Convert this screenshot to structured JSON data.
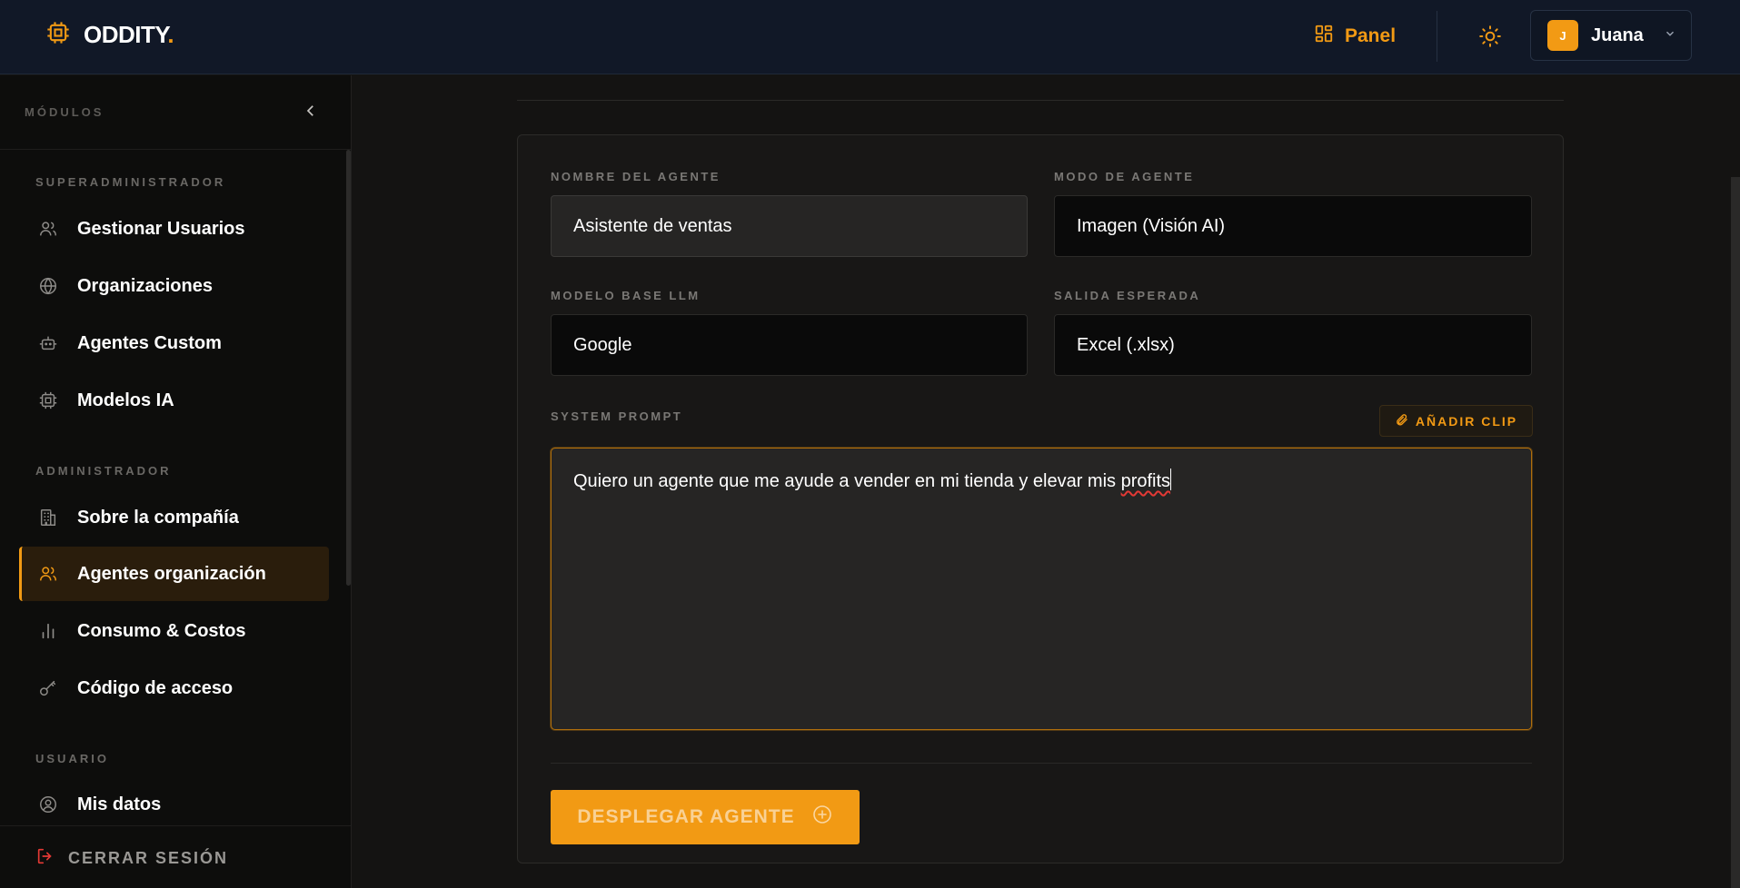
{
  "app": {
    "logo_text": "ODDITY",
    "logo_dot": ".",
    "logo_icon": "chip-icon"
  },
  "topbar": {
    "panel_label": "Panel",
    "panel_icon": "grid-icon",
    "theme_icon": "sun-icon",
    "user": {
      "initial": "J",
      "name": "Juana"
    }
  },
  "sidebar": {
    "title": "MÓDULOS",
    "sections": [
      {
        "title": "SUPERADMINISTRADOR",
        "items": [
          {
            "label": "Gestionar Usuarios",
            "icon": "users-icon"
          },
          {
            "label": "Organizaciones",
            "icon": "globe-icon"
          },
          {
            "label": "Agentes Custom",
            "icon": "bot-icon"
          },
          {
            "label": "Modelos IA",
            "icon": "chip-icon"
          }
        ]
      },
      {
        "title": "ADMINISTRADOR",
        "items": [
          {
            "label": "Sobre la compañía",
            "icon": "building-icon"
          },
          {
            "label": "Agentes organización",
            "icon": "users-icon",
            "active": true
          },
          {
            "label": "Consumo & Costos",
            "icon": "bar-chart-icon"
          },
          {
            "label": "Código de acceso",
            "icon": "key-icon"
          }
        ]
      },
      {
        "title": "USUARIO",
        "items": [
          {
            "label": "Mis datos",
            "icon": "user-circle-icon"
          }
        ]
      }
    ],
    "logout_label": "CERRAR SESIÓN"
  },
  "form": {
    "agent_name": {
      "label": "NOMBRE DEL AGENTE",
      "value": "Asistente de ventas"
    },
    "agent_mode": {
      "label": "MODO DE AGENTE",
      "value": "Imagen (Visión AI)"
    },
    "base_model": {
      "label": "MODELO BASE LLM",
      "value": "Google"
    },
    "output": {
      "label": "SALIDA ESPERADA",
      "value": "Excel (.xlsx)"
    },
    "system_prompt": {
      "label": "SYSTEM PROMPT",
      "value_prefix": "Quiero un agente que me ayude a vender en mi tienda y elevar mis ",
      "value_misspelled": "profits"
    },
    "clip_label": "AÑADIR CLIP",
    "deploy_label": "DESPLEGAR AGENTE"
  },
  "colors": {
    "accent": "#f29a14",
    "topbar_bg": "#111827",
    "sidebar_bg": "#0d0d0c",
    "main_bg": "#141312",
    "logout_icon": "#e53935"
  }
}
